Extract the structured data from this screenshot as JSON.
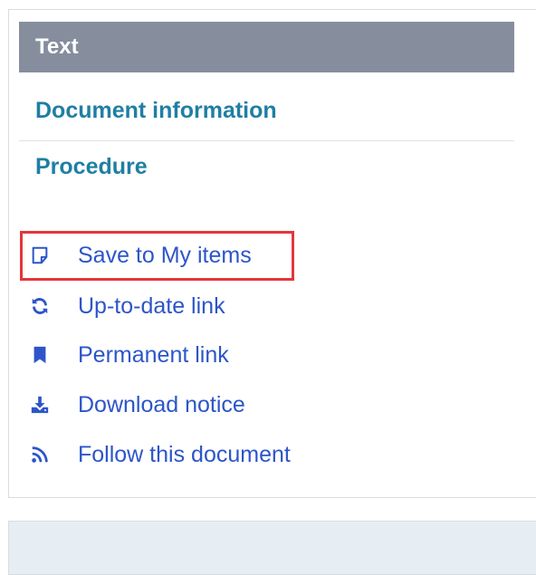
{
  "tab": {
    "label": "Text"
  },
  "nav": [
    {
      "label": "Document information"
    },
    {
      "label": "Procedure"
    }
  ],
  "actions": [
    {
      "label": "Save to My items",
      "icon": "note-icon"
    },
    {
      "label": "Up-to-date link",
      "icon": "refresh-icon"
    },
    {
      "label": "Permanent link",
      "icon": "bookmark-icon"
    },
    {
      "label": "Download notice",
      "icon": "download-icon"
    },
    {
      "label": "Follow this document",
      "icon": "rss-icon"
    }
  ],
  "colors": {
    "header_bg": "#868e9d",
    "nav_link": "#1f7fa3",
    "action_link": "#2d55c9",
    "highlight": "#e4363b"
  }
}
